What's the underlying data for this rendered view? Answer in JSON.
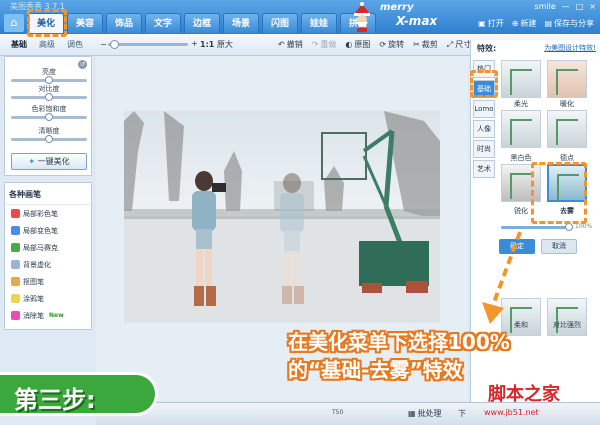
{
  "app": {
    "title": "美图秀秀 3.7.1"
  },
  "nav": {
    "home_icon": "home-icon",
    "tabs": [
      {
        "label": "美化",
        "active": true
      },
      {
        "label": "美容"
      },
      {
        "label": "饰品"
      },
      {
        "label": "文字"
      },
      {
        "label": "边框"
      },
      {
        "label": "场景"
      },
      {
        "label": "闪图"
      },
      {
        "label": "娃娃"
      },
      {
        "label": "拼图"
      }
    ],
    "banner": {
      "line1": "merry",
      "line2": "X-max"
    },
    "window_controls": [
      "smile",
      "—",
      "□",
      "×"
    ],
    "actions": [
      {
        "label": "打开",
        "icon": "folder-icon"
      },
      {
        "label": "新建",
        "icon": "plus-icon"
      },
      {
        "label": "保存与分享",
        "icon": "save-icon"
      }
    ]
  },
  "toolbar": {
    "subtabs": [
      {
        "label": "基础",
        "active": true
      },
      {
        "label": "高级"
      },
      {
        "label": "调色"
      }
    ],
    "ratio": "1:1",
    "original_size": "原大",
    "undo": "撤销",
    "redo": "重做",
    "original": "原图",
    "rotate": "旋转",
    "crop": "裁剪",
    "resize": "尺寸"
  },
  "adjust": {
    "sliders": [
      {
        "label": "亮度"
      },
      {
        "label": "对比度"
      },
      {
        "label": "色彩饱和度"
      },
      {
        "label": "清晰度"
      }
    ],
    "one_key": "一键美化"
  },
  "brushes": {
    "header": "各种画笔",
    "items": [
      {
        "label": "局部彩色笔",
        "color": "#e94b4b"
      },
      {
        "label": "局部变色笔",
        "color": "#4b8be9"
      },
      {
        "label": "局部马赛克",
        "color": "#4ba84b"
      },
      {
        "label": "背景虚化",
        "color": "#9ab4d8"
      },
      {
        "label": "抠图笔",
        "color": "#e9a84b"
      },
      {
        "label": "涂鸦笔",
        "color": "#e9d84b"
      },
      {
        "label": "消除笔",
        "color": "#e94bb4",
        "tag": "New"
      }
    ]
  },
  "effects": {
    "title": "特效:",
    "link": "为美图设计特效!",
    "vtabs": [
      {
        "label": "热门"
      },
      {
        "label": "基础",
        "active": true
      },
      {
        "label": "Lomo"
      },
      {
        "label": "人像"
      },
      {
        "label": "时尚"
      },
      {
        "label": "艺术"
      }
    ],
    "thumbs": [
      {
        "label": ""
      },
      {
        "label": ""
      },
      {
        "label": "柔光"
      },
      {
        "label": "暖化"
      },
      {
        "label": "黑白色"
      },
      {
        "label": "德点"
      },
      {
        "label": "锐化"
      },
      {
        "label": "去雾"
      },
      {
        "label": "柔和"
      },
      {
        "label": "对比强烈"
      }
    ],
    "intensity_percent": 100,
    "intensity_label": "100%",
    "ok": "确定",
    "cancel": "取消"
  },
  "status": {
    "zoom": "T50",
    "batch": "批处理",
    "download": "下"
  },
  "annotation": {
    "line1": "在美化菜单下选择100%",
    "line2": "的“基础-去雾”特效",
    "step": "第三步:",
    "highlight_color": "#f0962a"
  },
  "watermark": {
    "line1": "脚本之家",
    "line2": "www.jb51.net"
  }
}
